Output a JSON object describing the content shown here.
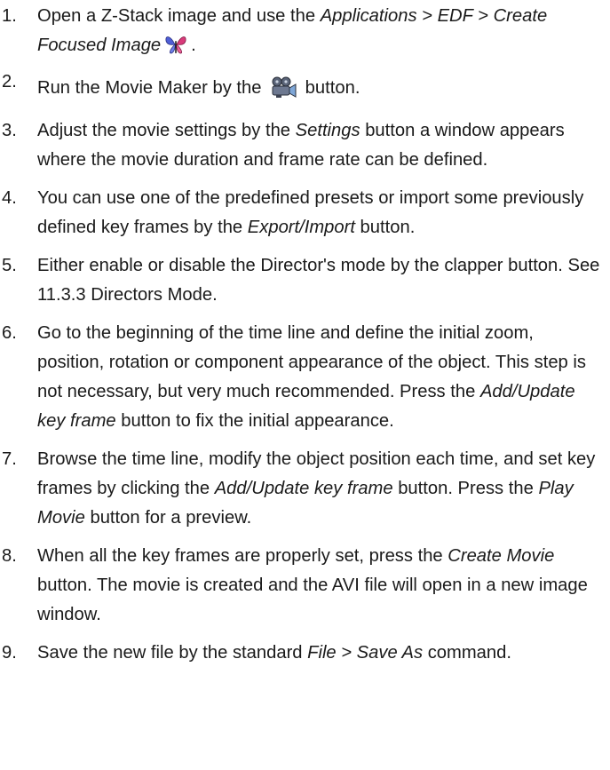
{
  "steps": [
    {
      "number": "1.",
      "parts": [
        {
          "t": "Open a Z-Stack image and use the "
        },
        {
          "t": "Applications > EDF > Create Focused Image",
          "i": true
        },
        {
          "icon": "butterfly-icon"
        },
        {
          "t": "."
        }
      ]
    },
    {
      "number": "2.",
      "parts": [
        {
          "t": "Run the Movie Maker by the "
        },
        {
          "icon": "movie-camera-icon"
        },
        {
          "t": " button."
        }
      ]
    },
    {
      "number": "3.",
      "parts": [
        {
          "t": "Adjust the movie settings by the "
        },
        {
          "t": "Settings",
          "i": true
        },
        {
          "t": " button a window appears where the movie duration and frame rate can be defined."
        }
      ]
    },
    {
      "number": "4.",
      "parts": [
        {
          "t": "You can use one of the predefined presets or import some previously defined key frames by the "
        },
        {
          "t": "Export/Import",
          "i": true
        },
        {
          "t": " but­ton."
        }
      ]
    },
    {
      "number": "5.",
      "parts": [
        {
          "t": "Either enable or disable the Director's mode by the clap­per button. See 11.3.3 Directors Mode."
        }
      ]
    },
    {
      "number": "6.",
      "parts": [
        {
          "t": "Go to the beginning of the time line and define the initial zoom, position, rotation or component appearance of the object. This step is not necessary, but very much recom­mended. Press the "
        },
        {
          "t": "Add/Update key frame",
          "i": true
        },
        {
          "t": " button to fix the initial appearance."
        }
      ]
    },
    {
      "number": "7.",
      "parts": [
        {
          "t": "Browse the time line, modify the object position each time, and set key frames by clicking the "
        },
        {
          "t": "Add/Update key frame",
          "i": true
        },
        {
          "t": " button. Press the "
        },
        {
          "t": "Play Movie",
          "i": true
        },
        {
          "t": " button for a preview."
        }
      ]
    },
    {
      "number": "8.",
      "parts": [
        {
          "t": "When all the key frames are properly set, press the "
        },
        {
          "t": "Create Movie",
          "i": true
        },
        {
          "t": " button. The movie is created and the AVI file will open in a new image window."
        }
      ]
    },
    {
      "number": "9.",
      "parts": [
        {
          "t": "Save the new file by the standard "
        },
        {
          "t": "File > Save As",
          "i": true
        },
        {
          "t": " com­mand."
        }
      ]
    }
  ]
}
